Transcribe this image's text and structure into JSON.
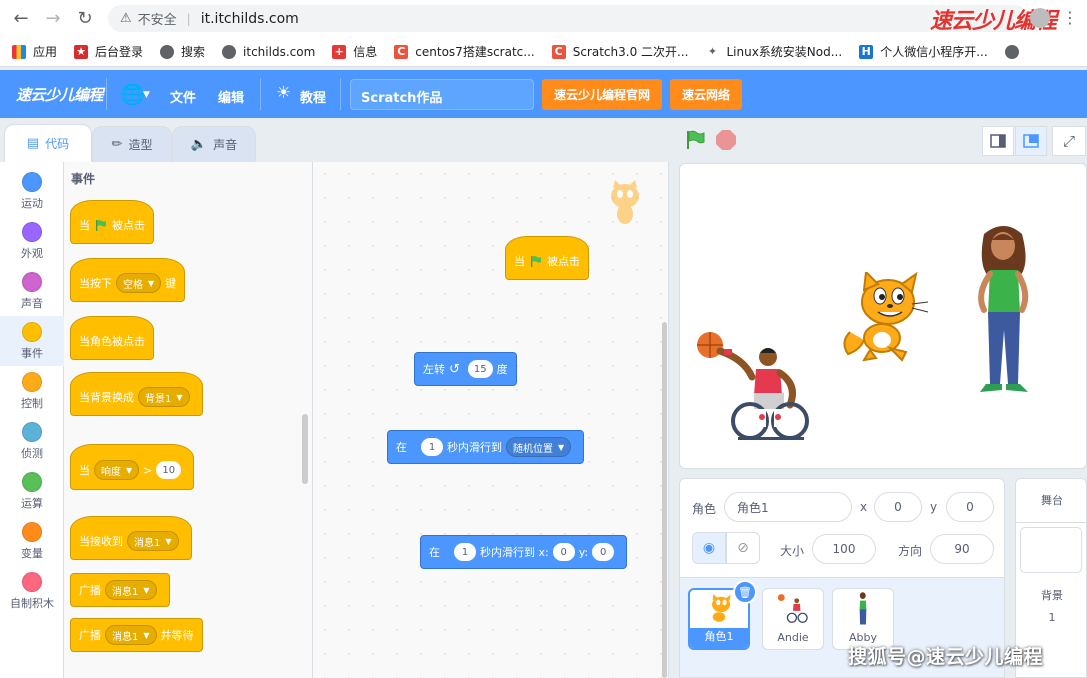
{
  "browser": {
    "insecure_label": "不安全",
    "url": "it.itchilds.com",
    "brand": "速云少儿编程",
    "bookmarks": [
      {
        "label": "应用",
        "icon": "apps-icon",
        "color": "#e53935"
      },
      {
        "label": "后台登录",
        "icon": "bookmark-icon",
        "color": "#d32f2f"
      },
      {
        "label": "搜索",
        "icon": "globe-icon",
        "color": "#5f6368"
      },
      {
        "label": "itchilds.com",
        "icon": "globe-icon",
        "color": "#5f6368"
      },
      {
        "label": "信息",
        "icon": "shield-icon",
        "color": "#e53935"
      },
      {
        "label": "centos7搭建scratc...",
        "icon": "csdn-icon",
        "color": "#e8543e"
      },
      {
        "label": "Scratch3.0 二次开...",
        "icon": "csdn-icon",
        "color": "#e8543e"
      },
      {
        "label": "Linux系统安装Nod...",
        "icon": "bookmark-icon",
        "color": "#5f6368"
      },
      {
        "label": "个人微信小程序开...",
        "icon": "h-icon",
        "color": "#1976d2"
      }
    ]
  },
  "menubar": {
    "logo": "速云少儿编程",
    "file": "文件",
    "edit": "编辑",
    "tutorials": "教程",
    "project_title": "Scratch作品",
    "btn_official": "速云少儿编程官网",
    "btn_network": "速云网络",
    "accent": "#4c97ff",
    "orange": "#ff8c1a"
  },
  "tabs": {
    "code": "代码",
    "costumes": "造型",
    "sounds": "声音"
  },
  "categories": [
    {
      "label": "运动",
      "color": "#4c97ff"
    },
    {
      "label": "外观",
      "color": "#9966ff"
    },
    {
      "label": "声音",
      "color": "#cf63cf"
    },
    {
      "label": "事件",
      "color": "#ffbf00"
    },
    {
      "label": "控制",
      "color": "#ffab19"
    },
    {
      "label": "侦测",
      "color": "#5cb1d6"
    },
    {
      "label": "运算",
      "color": "#59c059"
    },
    {
      "label": "变量",
      "color": "#ff8c1a"
    },
    {
      "label": "自制积木",
      "color": "#ff6680"
    }
  ],
  "palette": {
    "title": "事件",
    "when_flag": {
      "pre": "当",
      "post": "被点击"
    },
    "when_key": {
      "pre": "当按下",
      "key": "空格",
      "post": "键"
    },
    "when_sprite_clicked": "当角色被点击",
    "when_backdrop": {
      "pre": "当背景换成",
      "value": "背景1"
    },
    "when_greater": {
      "pre": "当",
      "sensor": "响度",
      "op": ">",
      "value": "10"
    },
    "when_receive": {
      "pre": "当接收到",
      "value": "消息1"
    },
    "broadcast": {
      "pre": "广播",
      "value": "消息1"
    },
    "broadcast_wait": {
      "pre": "广播",
      "value": "消息1",
      "post": "并等待"
    }
  },
  "workspace": {
    "hat": {
      "pre": "当",
      "post": "被点击"
    },
    "turn": {
      "pre": "左转",
      "value": "15",
      "post": "度"
    },
    "glide_random": {
      "pre": "在",
      "secs": "1",
      "mid": "秒内滑行到",
      "target": "随机位置"
    },
    "glide_xy": {
      "pre": "在",
      "secs": "1",
      "mid": "秒内滑行到 x:",
      "x": "0",
      "ylabel": "y:",
      "y": "0"
    }
  },
  "sprite_info": {
    "sprite_label": "角色",
    "sprite_name": "角色1",
    "x_label": "x",
    "x": "0",
    "y_label": "y",
    "y": "0",
    "size_label": "大小",
    "size": "100",
    "direction_label": "方向",
    "direction": "90"
  },
  "sprites": [
    {
      "name": "角色1",
      "selected": true
    },
    {
      "name": "Andie",
      "selected": false
    },
    {
      "name": "Abby",
      "selected": false
    }
  ],
  "stage_pane": {
    "title": "舞台",
    "backdrops_label": "背景",
    "backdrops_count": "1"
  },
  "watermark": "搜狐号@速云少儿编程"
}
